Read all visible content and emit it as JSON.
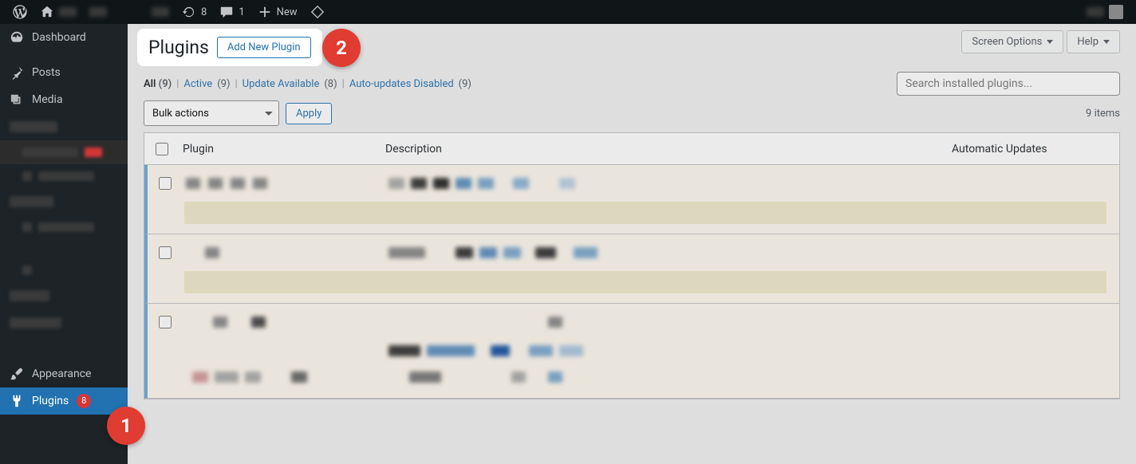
{
  "adminbar": {
    "updates_count": "8",
    "comments_count": "1",
    "new_label": "New"
  },
  "sidebar": {
    "dashboard": "Dashboard",
    "posts": "Posts",
    "media": "Media",
    "appearance": "Appearance",
    "plugins": "Plugins",
    "plugins_badge": "8"
  },
  "header": {
    "title": "Plugins",
    "add_new": "Add New Plugin",
    "screen_options": "Screen Options",
    "help": "Help"
  },
  "filters": {
    "all_label": "All",
    "all_count": "(9)",
    "active_label": "Active",
    "active_count": "(9)",
    "update_label": "Update Available",
    "update_count": "(8)",
    "auto_label": "Auto-updates Disabled",
    "auto_count": "(9)"
  },
  "search": {
    "placeholder": "Search installed plugins..."
  },
  "bulk": {
    "select_label": "Bulk actions",
    "apply": "Apply"
  },
  "count_text": "9 items",
  "table": {
    "col_plugin": "Plugin",
    "col_desc": "Description",
    "col_auto": "Automatic Updates"
  },
  "callouts": {
    "one": "1",
    "two": "2"
  }
}
